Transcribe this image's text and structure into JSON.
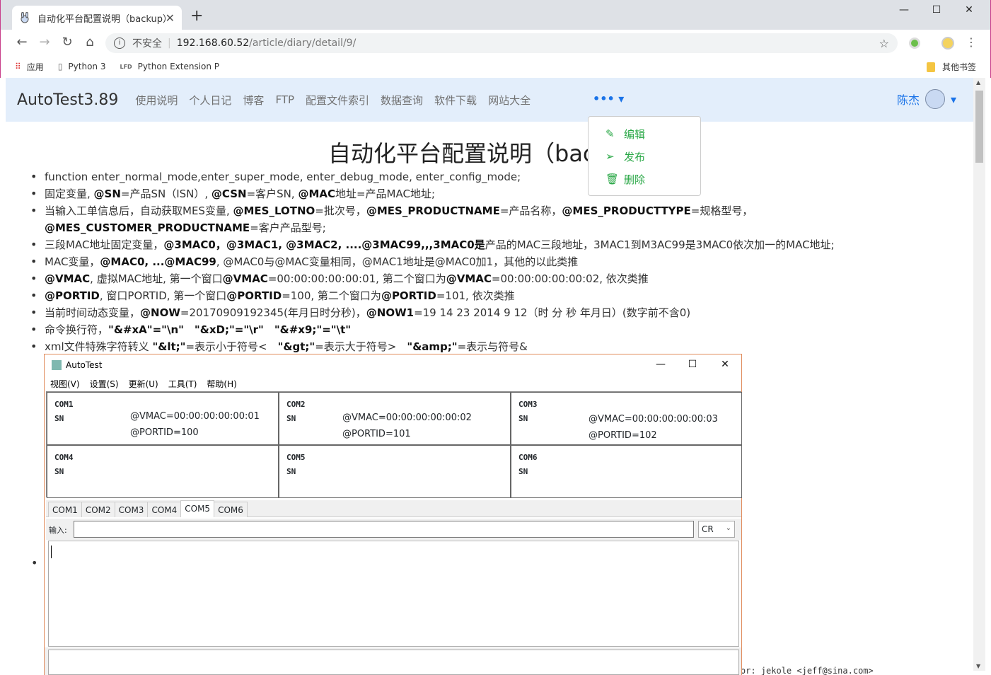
{
  "browser": {
    "tab_title": "自动化平台配置说明（backup）",
    "tab_close": "✕",
    "new_tab": "+",
    "insecure_label": "不安全",
    "url_host": "192.168.60.52",
    "url_path": "/article/diary/detail/9/",
    "bookmarks": [
      {
        "icon": "apps-icon",
        "label": "应用"
      },
      {
        "icon": "page-icon",
        "label": "Python 3"
      },
      {
        "icon": "lfd-icon",
        "label": "Python Extension P"
      }
    ],
    "other_bookmarks": "其他书签"
  },
  "navbar": {
    "brand": "AutoTest3.89",
    "links": [
      "使用说明",
      "个人日记",
      "博客",
      "FTP",
      "配置文件索引",
      "数据查询",
      "软件下载",
      "网站大全"
    ],
    "more": "••• ▾",
    "user": "陈杰",
    "user_caret": "▾"
  },
  "dropdown": {
    "items": [
      {
        "icon": "edit-icon",
        "label": "编辑"
      },
      {
        "icon": "send-icon",
        "label": "发布"
      },
      {
        "icon": "trash-icon",
        "label": "删除"
      }
    ]
  },
  "article": {
    "title": "自动化平台配置说明（backup）",
    "footer": "Author: jekole <jeff@sina.com>"
  },
  "autotest": {
    "title": "AutoTest",
    "menu": [
      "视图(V)",
      "设置(S)",
      "更新(U)",
      "工具(T)",
      "帮助(H)"
    ],
    "ports": [
      {
        "name": "COM1",
        "sn": "SN",
        "vmac": "@VMAC=00:00:00:00:00:01",
        "portid": "@PORTID=100"
      },
      {
        "name": "COM2",
        "sn": "SN",
        "vmac": "@VMAC=00:00:00:00:00:02",
        "portid": "@PORTID=101"
      },
      {
        "name": "COM3",
        "sn": "SN",
        "vmac": "@VMAC=00:00:00:00:00:03",
        "portid": "@PORTID=102"
      },
      {
        "name": "COM4",
        "sn": "SN",
        "vmac": "",
        "portid": ""
      },
      {
        "name": "COM5",
        "sn": "SN",
        "vmac": "",
        "portid": ""
      },
      {
        "name": "COM6",
        "sn": "SN",
        "vmac": "",
        "portid": ""
      }
    ],
    "tabs": [
      "COM1",
      "COM2",
      "COM3",
      "COM4",
      "COM5",
      "COM6"
    ],
    "active_tab": "COM5",
    "input_label": "输入:",
    "input_value": "",
    "line_ending": "CR"
  }
}
